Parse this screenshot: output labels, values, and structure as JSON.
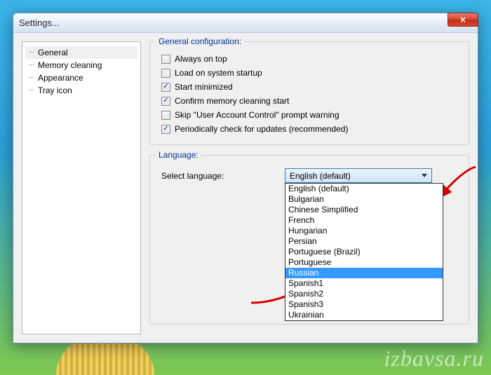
{
  "window": {
    "title": "Settings..."
  },
  "tree": {
    "items": [
      {
        "label": "General",
        "selected": true
      },
      {
        "label": "Memory cleaning",
        "selected": false
      },
      {
        "label": "Appearance",
        "selected": false
      },
      {
        "label": "Tray icon",
        "selected": false
      }
    ]
  },
  "general": {
    "group_title": "General configuration:",
    "options": [
      {
        "label": "Always on top",
        "checked": false
      },
      {
        "label": "Load on system startup",
        "checked": false
      },
      {
        "label": "Start minimized",
        "checked": true
      },
      {
        "label": "Confirm memory cleaning start",
        "checked": true
      },
      {
        "label": "Skip \"User Account Control\" prompt warning",
        "checked": false
      },
      {
        "label": "Periodically check for updates (recommended)",
        "checked": true
      }
    ]
  },
  "language": {
    "group_title": "Language:",
    "select_label": "Select language:",
    "selected": "English (default)",
    "options": [
      "English (default)",
      "Bulgarian",
      "Chinese Simplified",
      "French",
      "Hungarian",
      "Persian",
      "Portuguese (Brazil)",
      "Portuguese",
      "Russian",
      "Spanish1",
      "Spanish2",
      "Spanish3",
      "Ukrainian"
    ],
    "highlighted": "Russian"
  },
  "watermark": "izbavsa.ru"
}
